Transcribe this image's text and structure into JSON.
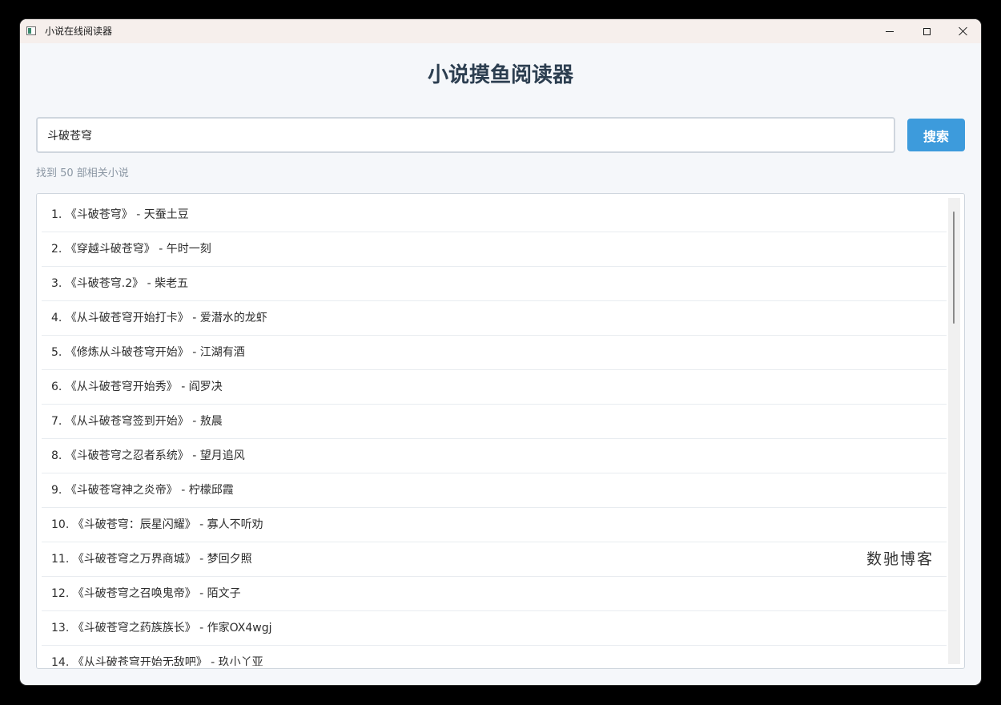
{
  "window": {
    "title": "小说在线阅读器",
    "icon": "app-window-icon",
    "controls": {
      "minimize": "minimize-icon",
      "maximize": "maximize-icon",
      "close": "close-icon"
    }
  },
  "header": {
    "title": "小说摸鱼阅读器"
  },
  "search": {
    "value": "斗破苍穹",
    "button_label": "搜索",
    "button_color": "#3d9bdc"
  },
  "result_count": "找到 50 部相关小说",
  "results": [
    "1. 《斗破苍穹》 - 天蚕土豆",
    "2. 《穿越斗破苍穹》 - 午时一刻",
    "3. 《斗破苍穹.2》 - 柴老五",
    "4. 《从斗破苍穹开始打卡》 - 爱潜水的龙虾",
    "5. 《修炼从斗破苍穹开始》 - 江湖有酒",
    "6. 《从斗破苍穹开始秀》 - 阎罗决",
    "7. 《从斗破苍穹签到开始》 - 敖晨",
    "8. 《斗破苍穹之忍者系统》 - 望月追风",
    "9. 《斗破苍穹神之炎帝》 - 柠檬邱霞",
    "10. 《斗破苍穹：辰星闪耀》 - 寡人不听劝",
    "11. 《斗破苍穹之万界商城》 - 梦回夕照",
    "12. 《斗破苍穹之召唤鬼帝》 - 陌文子",
    "13. 《斗破苍穹之药族族长》 - 作家OX4wgj",
    "14. 《从斗破苍穹开始无敌吧》 - 玖小丫亚"
  ],
  "watermark": "数驰博客"
}
